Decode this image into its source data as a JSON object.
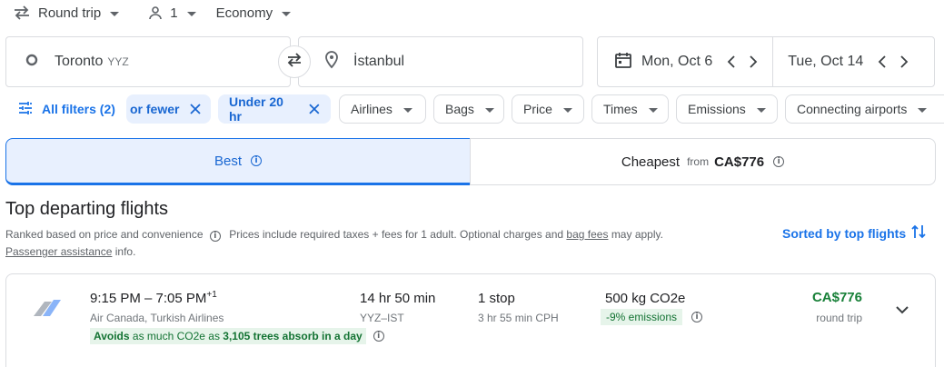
{
  "search": {
    "trip_type": "Round trip",
    "passengers": "1",
    "cabin_class": "Economy",
    "origin_city": "Toronto",
    "origin_code": "YYZ",
    "destination": "İstanbul",
    "depart_date": "Mon, Oct 6",
    "return_date": "Tue, Oct 14"
  },
  "filters": {
    "all_filters": "All filters (2)",
    "active": [
      "or fewer",
      "Under 20 hr"
    ],
    "dropdowns": [
      "Airlines",
      "Bags",
      "Price",
      "Times",
      "Emissions",
      "Connecting airports"
    ]
  },
  "tabs": {
    "best": "Best",
    "cheapest": "Cheapest",
    "cheapest_from": "from",
    "cheapest_price": "CA$776"
  },
  "results": {
    "heading": "Top departing flights",
    "ranked_note": "Ranked based on price and convenience",
    "price_note": "Prices include required taxes + fees for 1 adult. Optional charges and",
    "bag_fees_link": "bag fees",
    "may_apply": "may apply.",
    "passenger_assistance_link": "Passenger assistance",
    "info_suffix": "info.",
    "sorted_label": "Sorted by top flights"
  },
  "flights": [
    {
      "times": "9:15 PM – 7:05 PM",
      "day_offset": "+1",
      "airlines": "Air Canada, Turkish Airlines",
      "duration": "14 hr 50 min",
      "route": "YYZ–IST",
      "stops": "1 stop",
      "layover": "3 hr 55 min CPH",
      "emissions": "500 kg CO2e",
      "emissions_delta": "-9% emissions",
      "price": "CA$776",
      "price_type": "round trip",
      "eco_avoids": "Avoids",
      "eco_mid": "as much CO2e as",
      "eco_bold": "3,105 trees absorb in a day"
    }
  ],
  "colors": {
    "accent": "#1a73e8",
    "price_green": "#188038",
    "eco_bg": "#e6f4ea"
  }
}
